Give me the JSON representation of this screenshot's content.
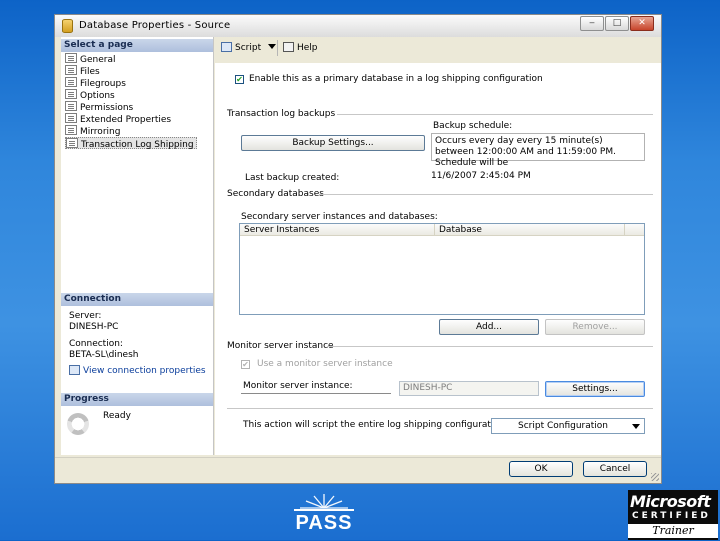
{
  "window": {
    "title": "Database Properties - Source",
    "minimize": "‒",
    "maximize": "□",
    "close": "✕"
  },
  "left_pane": {
    "select_page_header": "Select a page",
    "pages": [
      "General",
      "Files",
      "Filegroups",
      "Options",
      "Permissions",
      "Extended Properties",
      "Mirroring",
      "Transaction Log Shipping"
    ],
    "connection_header": "Connection",
    "server_label": "Server:",
    "server_value": "DINESH-PC",
    "connection_label": "Connection:",
    "connection_value": "BETA-SL\\dinesh",
    "view_connection_link": "View connection properties",
    "progress_header": "Progress",
    "progress_status": "Ready"
  },
  "toolbar": {
    "script_label": "Script",
    "help_label": "Help"
  },
  "main": {
    "enable_primary_label": "Enable this as a primary database in a log shipping configuration",
    "enable_primary_checked": true,
    "tlog_backups_group": "Transaction log backups",
    "backup_settings_button": "Backup Settings...",
    "backup_schedule_label": "Backup schedule:",
    "backup_schedule_text": "Occurs every day every 15 minute(s) between 12:00:00 AM and 11:59:00 PM. Schedule will be",
    "last_backup_label": "Last backup created:",
    "last_backup_value": "11/6/2007 2:45:04 PM",
    "secondary_db_group": "Secondary databases",
    "secondary_list_label": "Secondary server instances and databases:",
    "secondary_columns": [
      "Server Instances",
      "Database"
    ],
    "add_button": "Add...",
    "remove_button": "Remove...",
    "monitor_group": "Monitor server instance",
    "use_monitor_label": "Use a monitor server instance",
    "use_monitor_checked": true,
    "monitor_instance_label": "Monitor server instance:",
    "monitor_instance_value": "DINESH-PC",
    "settings_button": "Settings...",
    "script_note": "This action will script the entire log shipping configuration.",
    "script_config_combo": "Script Configuration"
  },
  "footer": {
    "ok_button": "OK",
    "cancel_button": "Cancel"
  },
  "logos": {
    "pass_text": "PASS",
    "ms_line1": "Microsoft",
    "ms_line2": "CERTIFIED",
    "ms_line3": "Trainer"
  }
}
